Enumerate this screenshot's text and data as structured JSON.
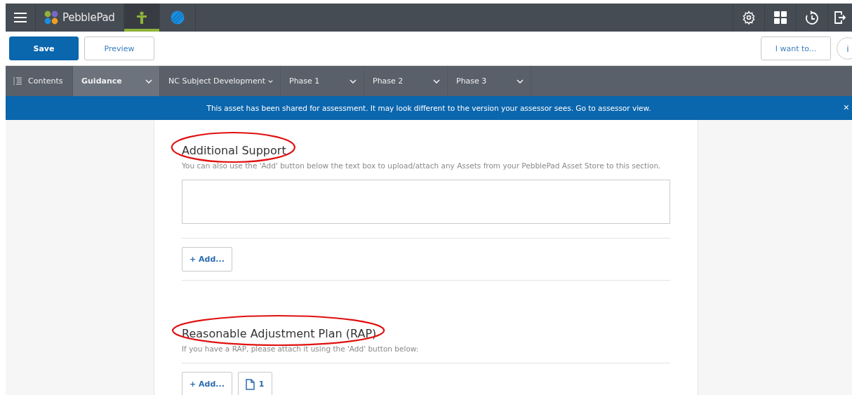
{
  "top_bar": {
    "brand": "PebblePad",
    "apps": [
      {
        "kind": "person",
        "selected": true
      },
      {
        "kind": "globe",
        "selected": false
      }
    ]
  },
  "toolbar": {
    "save": "Save",
    "preview": "Preview",
    "menu": "I want to...",
    "info": "i"
  },
  "nav": [
    {
      "kind": "contents",
      "label": "Contents",
      "selected": false
    },
    {
      "kind": "dropdown",
      "label": "Guidance",
      "selected": true
    },
    {
      "kind": "dropdown",
      "label": "NC Subject Development",
      "selected": false
    },
    {
      "kind": "dropdown",
      "label": "Phase 1",
      "selected": false
    },
    {
      "kind": "dropdown",
      "label": "Phase 2",
      "selected": false
    },
    {
      "kind": "dropdown",
      "label": "Phase 3",
      "selected": false
    }
  ],
  "banner": {
    "text": "This asset has been shared for assessment. It may look different to the version your assessor sees. Go to assessor view.",
    "close": "×"
  },
  "sections": [
    {
      "title": "Additional Support",
      "circled": true,
      "description": "You can also use the 'Add' button below the text box to upload/attach any Assets from your PebblePad Asset Store to this section.",
      "text_box": true,
      "add": "+ Add..."
    },
    {
      "title": "Reasonable Adjustment Plan (RAP)",
      "circled": true,
      "description": "If you have a RAP, please attach it using the 'Add' button below:",
      "text_box": false,
      "add": "+ Add...",
      "attachments": [
        {
          "count": "1"
        }
      ]
    }
  ]
}
